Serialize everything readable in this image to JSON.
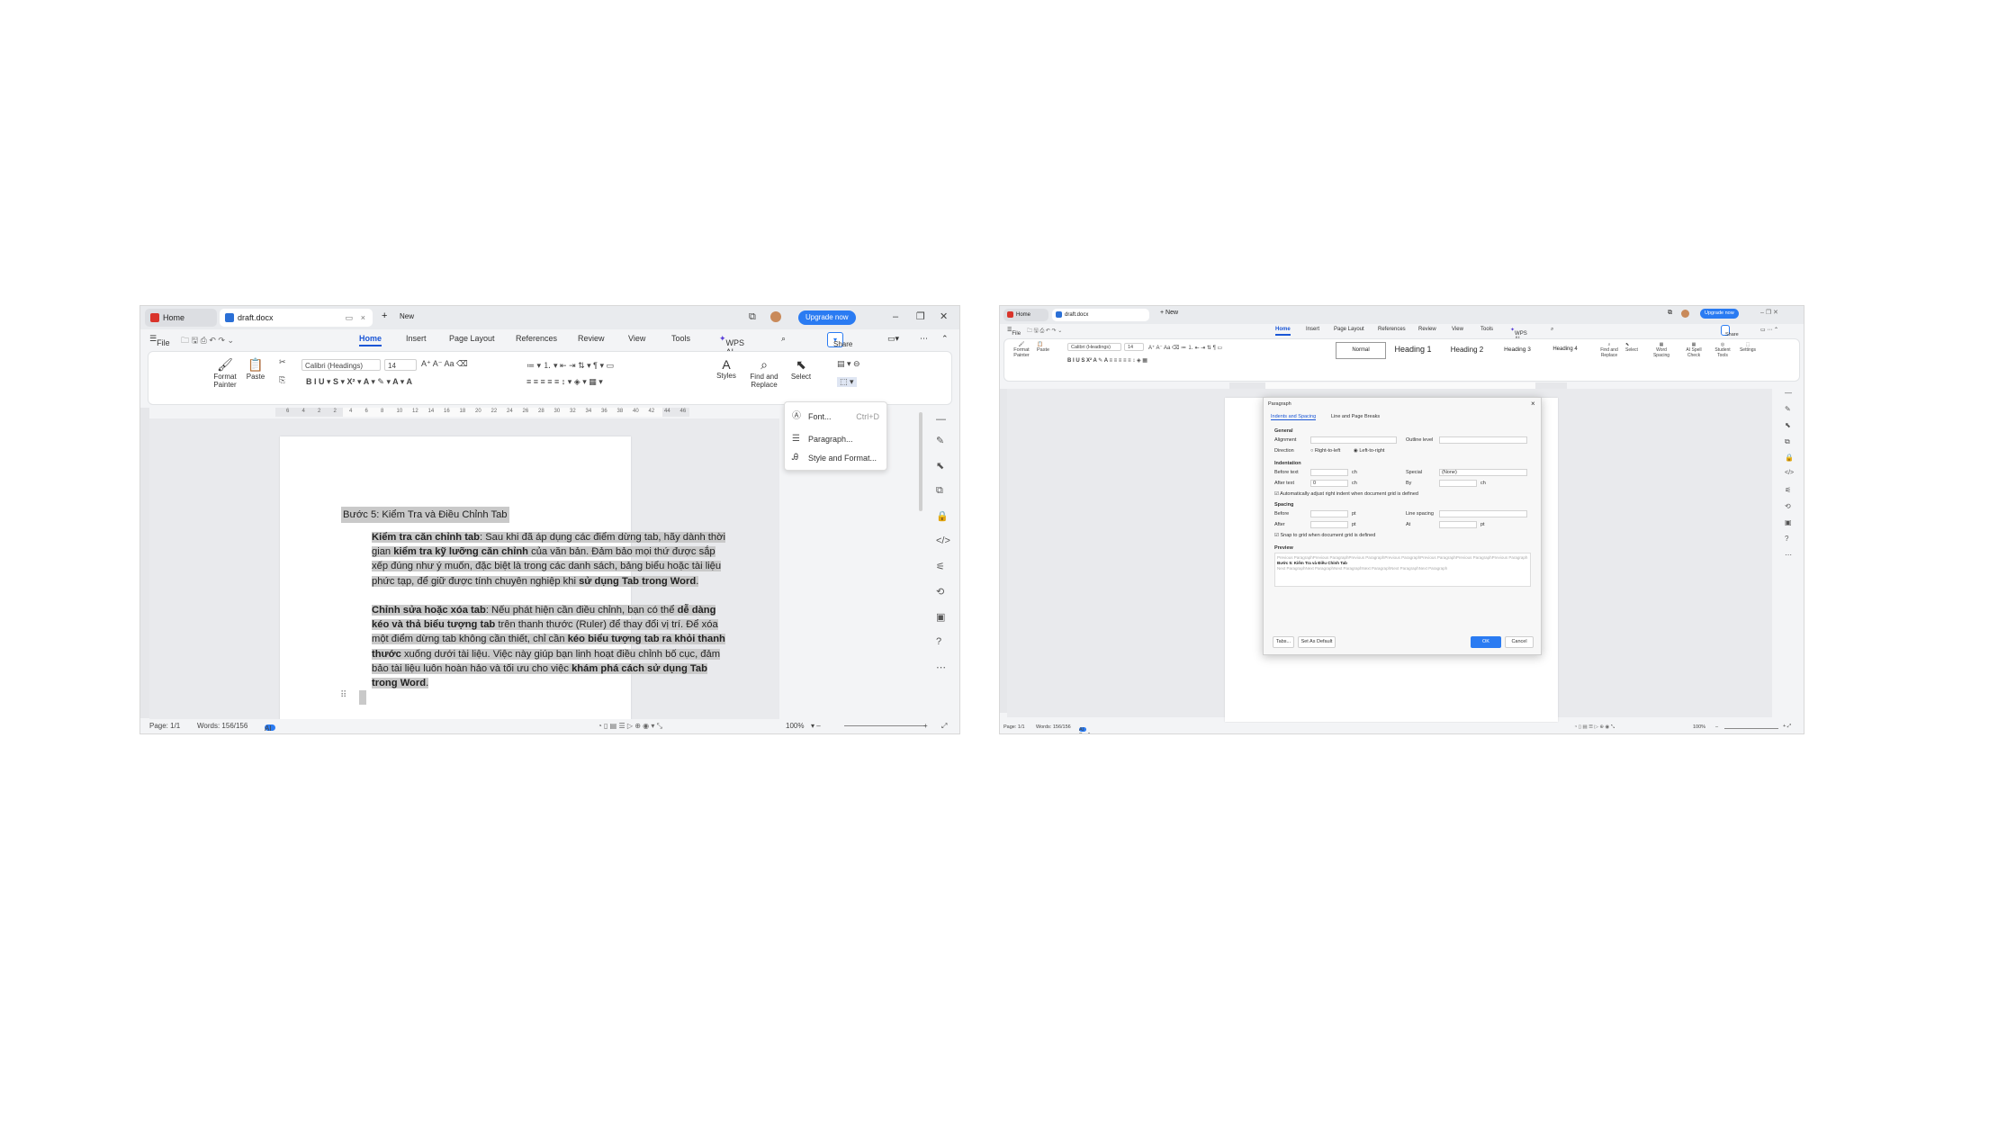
{
  "left": {
    "tabs": {
      "home": "Home",
      "doc": "draft.docx",
      "new": "New"
    },
    "upgrade": "Upgrade now",
    "menu": {
      "file": "File",
      "home": "Home",
      "insert": "Insert",
      "page_layout": "Page Layout",
      "references": "References",
      "review": "Review",
      "view": "View",
      "tools": "Tools",
      "wps_ai": "WPS AI",
      "share": "Share"
    },
    "ribbon": {
      "format_painter": "Format Painter",
      "paste": "Paste",
      "font_name": "Calibri (Headings)",
      "font_size": "14",
      "styles": "Styles",
      "find_replace": "Find and Replace",
      "select": "Select"
    },
    "ruler_labels": [
      "6",
      "4",
      "2",
      "2",
      "4",
      "6",
      "8",
      "10",
      "12",
      "14",
      "16",
      "18",
      "20",
      "22",
      "24",
      "26",
      "28",
      "30",
      "32",
      "34",
      "36",
      "38",
      "40",
      "42",
      "44",
      "46"
    ],
    "doc": {
      "heading": "Bước 5: Kiểm Tra và Điều Chỉnh Tab",
      "p1": [
        {
          "t": "Kiểm tra căn chỉnh tab",
          "b": true
        },
        {
          "t": ": Sau khi đã áp dụng các điểm dừng tab, hãy dành thời gian ",
          "b": false
        },
        {
          "t": "kiểm tra kỹ lưỡng căn chỉnh",
          "b": true
        },
        {
          "t": " của văn bản. Đảm bảo mọi thứ được sắp xếp đúng như ý muốn, đặc biệt là trong các danh sách, bảng biểu hoặc tài liệu phức tạp, để giữ được tính chuyên nghiệp khi ",
          "b": false
        },
        {
          "t": "sử dụng Tab trong Word",
          "b": true
        },
        {
          "t": ".",
          "b": false
        }
      ],
      "p2": [
        {
          "t": "Chỉnh sửa hoặc xóa tab",
          "b": true
        },
        {
          "t": ": Nếu phát hiện cần điều chỉnh, bạn có thể ",
          "b": false
        },
        {
          "t": "dễ dàng kéo và thả biểu tượng tab",
          "b": true
        },
        {
          "t": " trên thanh thước (Ruler) để thay đổi vị trí. Để xóa một điểm dừng tab không cần thiết, chỉ cần ",
          "b": false
        },
        {
          "t": "kéo biểu tượng tab ra khỏi thanh thước",
          "b": true
        },
        {
          "t": " xuống dưới tài liệu. Việc này giúp bạn linh hoạt điều chỉnh bố cục, đảm bảo tài liệu luôn hoàn hảo và tối ưu cho việc ",
          "b": false
        },
        {
          "t": "khám phá cách sử dụng Tab trong Word",
          "b": true
        },
        {
          "t": ".",
          "b": false
        }
      ]
    },
    "context_menu": {
      "font": "Font...",
      "font_shortcut": "Ctrl+D",
      "paragraph": "Paragraph...",
      "style_format": "Style and Format..."
    },
    "status": {
      "page": "Page: 1/1",
      "words": "Words: 156/156",
      "spell": "AI Spell Check",
      "zoom": "100%"
    }
  },
  "right": {
    "tabs": {
      "home": "Home",
      "doc": "draft.docx",
      "new": "New"
    },
    "upgrade": "Upgrade now",
    "menu": {
      "file": "File",
      "home": "Home",
      "insert": "Insert",
      "page_layout": "Page Layout",
      "references": "References",
      "review": "Review",
      "view": "View",
      "tools": "Tools",
      "wps_ai": "WPS AI",
      "share": "Share"
    },
    "ribbon": {
      "format_painter": "Format Painter",
      "paste": "Paste",
      "font_name": "Calibri (Headings)",
      "font_size": "14",
      "styles": [
        "Normal",
        "Heading 1",
        "Heading 2",
        "Heading 3",
        "Heading 4"
      ],
      "find_replace": "Find and Replace",
      "select": "Select",
      "word_spacing": "Word Spacing",
      "ai_spell": "AI Spell Check",
      "student_tools": "Student Tools",
      "settings": "Settings"
    },
    "dialog": {
      "title": "Paragraph",
      "tab1": "Indents and Spacing",
      "tab2": "Line and Page Breaks",
      "general": "General",
      "alignment": "Alignment",
      "outline_level": "Outline level",
      "direction": "Direction",
      "rtl": "Right-to-left",
      "ltr": "Left-to-right",
      "indentation": "Indentation",
      "before_text": "Before text",
      "after_text": "After text",
      "after_text_value": "0",
      "unit_ch": "ch",
      "special": "Special",
      "special_value": "(None)",
      "by": "By",
      "auto_adjust": "Automatically adjust right indent when document grid is defined",
      "spacing": "Spacing",
      "before": "Before",
      "after": "After",
      "unit_pt": "pt",
      "line_spacing": "Line spacing",
      "at": "At",
      "snap": "Snap to grid when document grid is defined",
      "preview": "Preview",
      "preview_prev": "Previous ParagraphPrevious ParagraphPrevious ParagraphPrevious ParagraphPrevious ParagraphPrevious ParagraphPrevious Paragraph",
      "preview_cur": "Bước 5: Kiểm Tra và Điều Chỉnh Tab",
      "preview_next": "Next ParagraphNext ParagraphNext ParagraphNext ParagraphNext ParagraphNext Paragraph",
      "tabs_btn": "Tabs...",
      "default_btn": "Set As Default",
      "ok": "OK",
      "cancel": "Cancel"
    },
    "status": {
      "page": "Page: 1/1",
      "words": "Words: 156/156",
      "spell": "AI Spell Check",
      "zoom": "100%"
    }
  },
  "colors": {
    "accent": "#2a7bf2",
    "highlight": "#c9c9c9",
    "wps_red": "#d9342b"
  }
}
